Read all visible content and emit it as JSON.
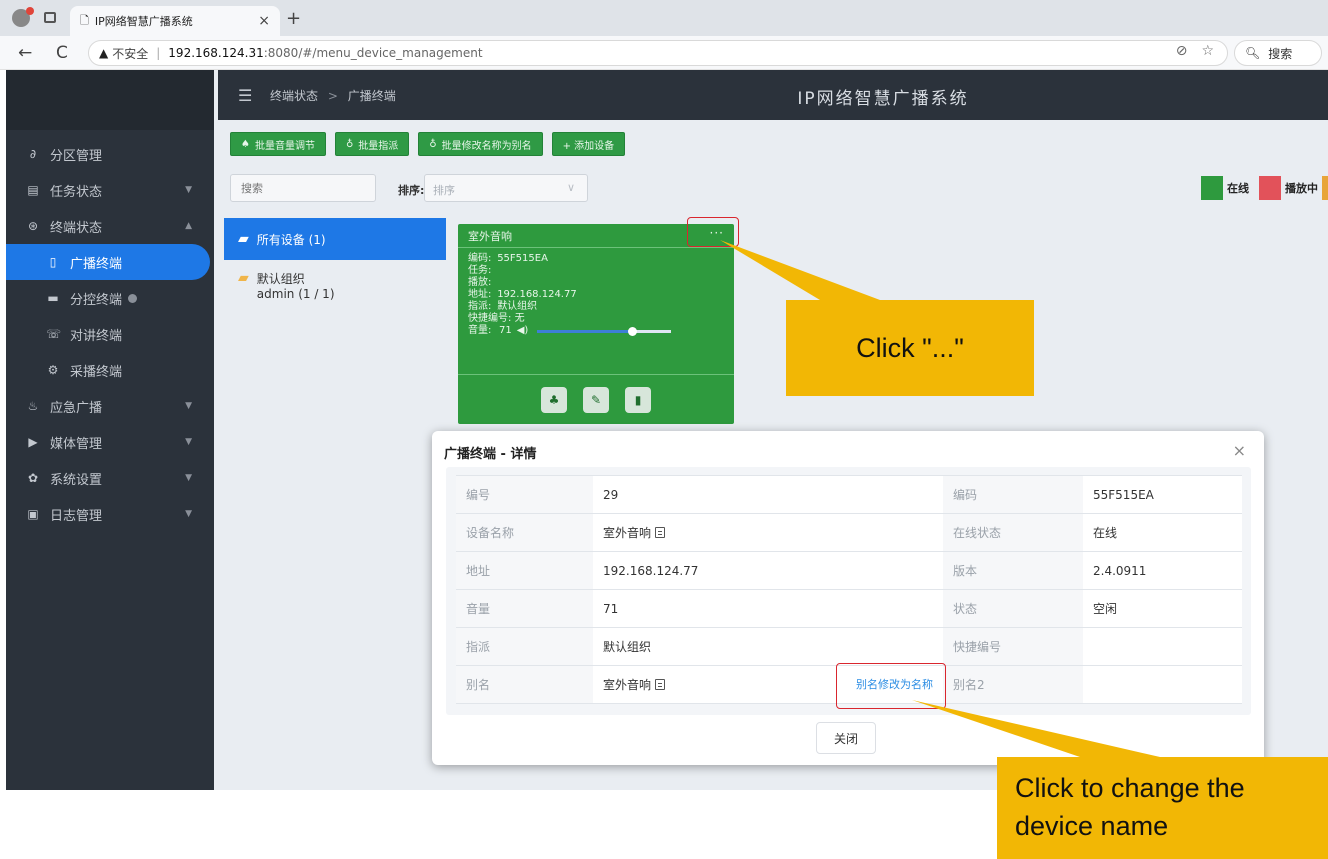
{
  "browser": {
    "tab_title": "IP网络智慧广播系统",
    "tab_close": "×",
    "new_tab": "+",
    "back": "←",
    "reload": "C",
    "insecure_label": "不安全",
    "url_host": "192.168.124.31",
    "url_path": ":8080/#/menu_device_management",
    "search_label": "搜索"
  },
  "sidebar": {
    "items": [
      {
        "label": "分区管理",
        "icon": "link-icon"
      },
      {
        "label": "任务状态",
        "icon": "task-icon"
      },
      {
        "label": "终端状态",
        "icon": "terminal-icon"
      },
      {
        "label": "广播终端",
        "icon": "broadcast-icon"
      },
      {
        "label": "分控终端",
        "icon": "monitor-icon"
      },
      {
        "label": "对讲终端",
        "icon": "intercom-icon"
      },
      {
        "label": "采播终端",
        "icon": "capture-icon"
      },
      {
        "label": "应急广播",
        "icon": "emergency-icon"
      },
      {
        "label": "媒体管理",
        "icon": "media-icon"
      },
      {
        "label": "系统设置",
        "icon": "settings-icon"
      },
      {
        "label": "日志管理",
        "icon": "log-icon"
      }
    ]
  },
  "header": {
    "breadcrumb_parent": "终端状态",
    "breadcrumb_sep": ">",
    "breadcrumb_current": "广播终端",
    "app_title": "IP网络智慧广播系统"
  },
  "toolbar": {
    "buttons": [
      "批量音量调节",
      "批量指派",
      "批量修改名称为别名",
      "+ 添加设备"
    ]
  },
  "filter": {
    "search_placeholder": "搜索",
    "sort_label": "排序:",
    "sort_placeholder": "排序",
    "legend_online": "在线",
    "legend_playing": "播放中",
    "color_online": "#2e9a3e",
    "color_playing": "#e2525a",
    "color_third": "#e8a53a"
  },
  "groups": {
    "all": "所有设备 (1)",
    "default_line1": "默认组织",
    "default_line2": "admin (1 / 1)"
  },
  "device": {
    "name": "室外音响",
    "more": "···",
    "code_label": "编码:",
    "code": "55F515EA",
    "task_label": "任务:",
    "play_label": "播放:",
    "addr_label": "地址:",
    "addr": "192.168.124.77",
    "assign_label": "指派:",
    "assign": "默认组织",
    "quick_label": "快捷编号:",
    "quick": "无",
    "vol_label": "音量:",
    "vol": "71",
    "volume_fraction": 0.71
  },
  "modal": {
    "title": "广播终端 - 详情",
    "close_x": "×",
    "rows": [
      {
        "k1": "编号",
        "v1": "29",
        "k2": "编码",
        "v2": "55F515EA"
      },
      {
        "k1": "设备名称",
        "v1": "室外音响",
        "k2": "在线状态",
        "v2": "在线"
      },
      {
        "k1": "地址",
        "v1": "192.168.124.77",
        "k2": "版本",
        "v2": "2.4.0911"
      },
      {
        "k1": "音量",
        "v1": "71",
        "k2": "状态",
        "v2": "空闲"
      },
      {
        "k1": "指派",
        "v1": "默认组织",
        "k2": "快捷编号",
        "v2": ""
      },
      {
        "k1": "别名",
        "v1": "室外音响",
        "k2": "别名2",
        "v2": ""
      }
    ],
    "alias_link": "别名修改为名称",
    "close_button": "关闭"
  },
  "annotations": {
    "callout1": "Click \"...\"",
    "callout2": "Click to change the device name"
  }
}
